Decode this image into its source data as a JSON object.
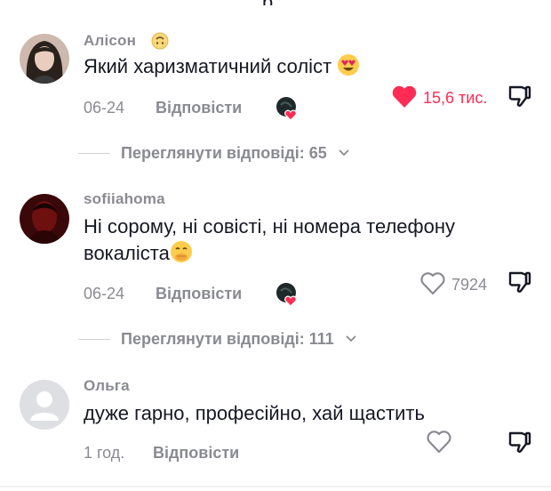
{
  "top_fragment": "р",
  "comments": [
    {
      "username": "Алісон",
      "text": "Який харизматичний соліст",
      "date": "06-24",
      "reply_label": "Відповісти",
      "likes": "15,6 тис.",
      "liked": true,
      "creator_liked": true,
      "view_replies": "Переглянути відповіді: 65"
    },
    {
      "username": "sofiiahoma",
      "text_line1": "Ні сорому, ні совісті, ні номера телефону",
      "text_line2": "вокаліста",
      "date": "06-24",
      "reply_label": "Відповісти",
      "likes": "7924",
      "liked": false,
      "creator_liked": true,
      "view_replies": "Переглянути відповіді: 111"
    },
    {
      "username": "Ольга",
      "text": "дуже гарно, професійно, хай щастить",
      "date": "1 год.",
      "reply_label": "Відповісти",
      "likes": "",
      "liked": false,
      "creator_liked": false
    }
  ],
  "colors": {
    "like_red": "#fe2c55",
    "muted": "#8a8b91",
    "text": "#161823"
  },
  "icons": [
    "heart-icon",
    "dislike-icon",
    "chevron-down-icon",
    "creator-liked-icon",
    "smiling-face-heart-eyes-emoji",
    "smiling-face-hand-over-mouth-emoji",
    "upside-down-face-emoji"
  ]
}
